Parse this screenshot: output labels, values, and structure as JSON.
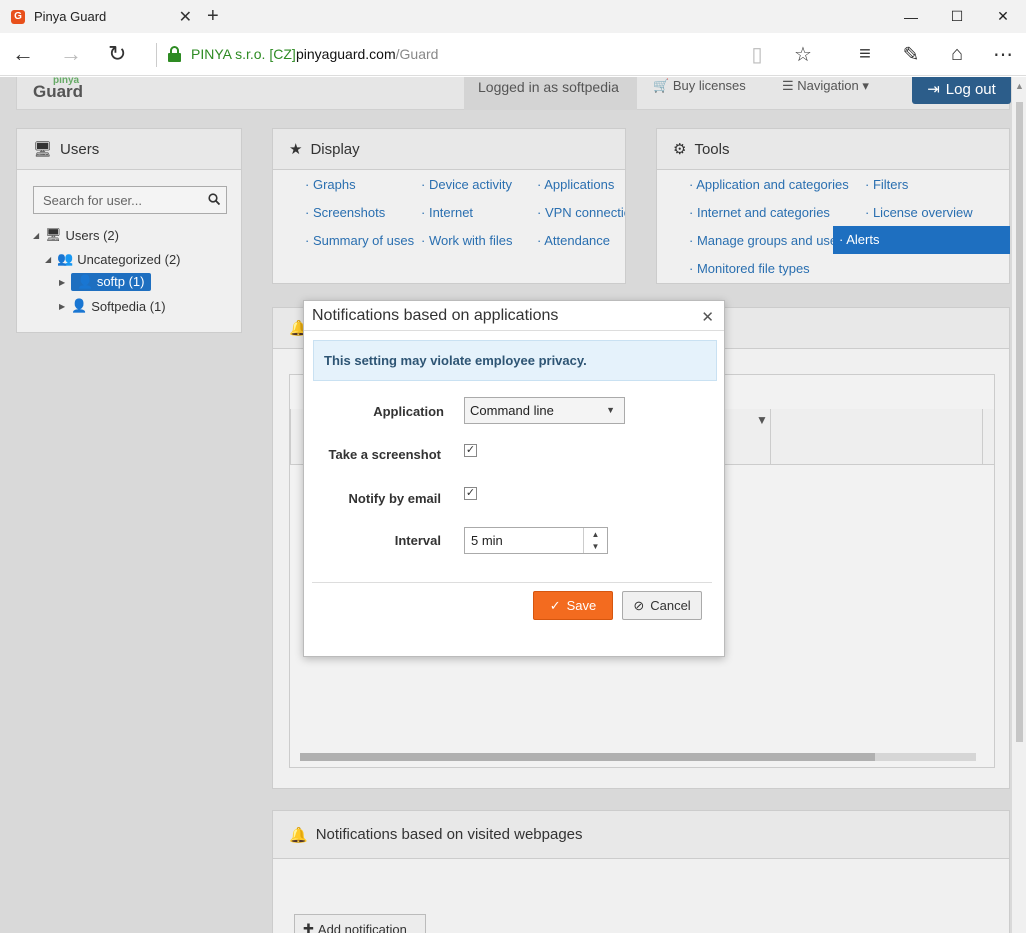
{
  "browser": {
    "tab_title": "Pinya Guard",
    "tab_favicon": "G",
    "cert_label": "PINYA s.r.o. [CZ]",
    "url_domain": "pinyaguard.com",
    "url_path": "/Guard"
  },
  "topnav": {
    "logo_top": "pinya",
    "logo_main": "Guard",
    "logged_in": "Logged in as softpedia",
    "buy": "Buy licenses",
    "navigation": "Navigation",
    "logout": "Log out"
  },
  "users": {
    "title": "Users",
    "search_placeholder": "Search for user...",
    "tree": {
      "root": "Users (2)",
      "group": "Uncategorized (2)",
      "user1": "softp (1)",
      "user2": "Softpedia (1)"
    }
  },
  "display": {
    "title": "Display",
    "links": [
      "Graphs",
      "Device activity",
      "Applications",
      "Screenshots",
      "Internet",
      "VPN connections",
      "Summary of uses",
      "Work with files",
      "Attendance"
    ]
  },
  "tools": {
    "title": "Tools",
    "links": [
      "Application and categories",
      "Filters",
      "Internet and categories",
      "License overview",
      "Manage groups and users",
      "Alerts",
      "Monitored file types"
    ]
  },
  "webpages_panel": {
    "title": "Notifications based on visited webpages",
    "add_button": "Add notification"
  },
  "dialog": {
    "title": "Notifications based on applications",
    "alert": "This setting may violate employee privacy.",
    "application_label": "Application",
    "application_value": "Command line",
    "screenshot_label": "Take a screenshot",
    "email_label": "Notify by email",
    "interval_label": "Interval",
    "interval_value": "5 min",
    "save": "Save",
    "cancel": "Cancel"
  },
  "colors": {
    "accent": "#1e6fc0",
    "logout": "#2c5d8a",
    "save": "#f36b1f",
    "secure": "#2e8b23"
  }
}
